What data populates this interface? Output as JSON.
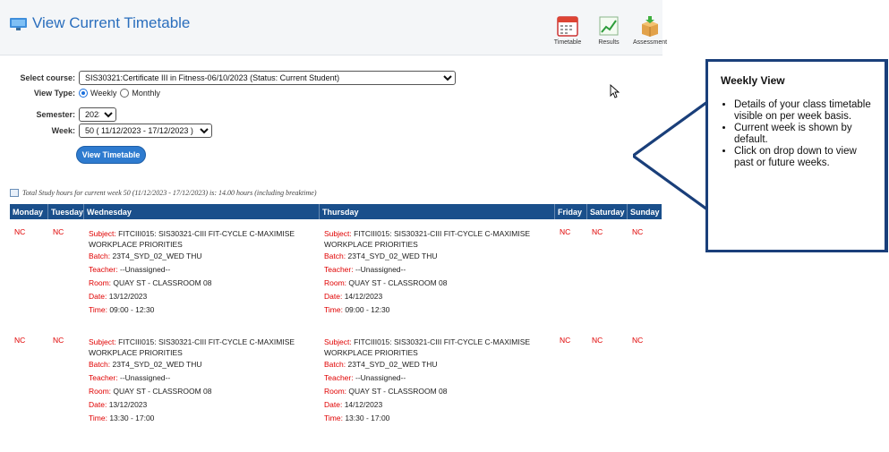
{
  "header": {
    "title": "View Current Timetable",
    "title_icon": "monitor-icon",
    "quick_links": [
      {
        "label": "Timetable",
        "icon": "calendar-icon"
      },
      {
        "label": "Results",
        "icon": "chart-icon"
      },
      {
        "label": "Assessment",
        "icon": "box-icon"
      }
    ]
  },
  "form": {
    "course_label": "Select course:",
    "course_value": "SIS30321:Certificate III in Fitness-06/10/2023 (Status: Current Student)",
    "view_type_label": "View Type:",
    "view_type_options": [
      "Weekly",
      "Monthly"
    ],
    "view_type_selected": "Weekly",
    "semester_label": "Semester:",
    "semester_value": "2023",
    "week_label": "Week:",
    "week_value": "50 ( 11/12/2023 - 17/12/2023 )",
    "view_button": "View Timetable"
  },
  "summary": "Total Study hours for current week 50 (11/12/2023 - 17/12/2023) is: 14.00 hours (including breaktime)",
  "table": {
    "headers": [
      "Monday",
      "Tuesday",
      "Wednesday",
      "Thursday",
      "Friday",
      "Saturday",
      "Sunday"
    ],
    "nc": "NC",
    "rows": [
      {
        "wednesday": {
          "subject_label": "Subject:",
          "subject_value": "FITCIII015: SIS30321-CIII FIT-CYCLE C-MAXIMISE",
          "subject_cont": "WORKPLACE PRIORITIES",
          "batch_label": "Batch:",
          "batch_value": "23T4_SYD_02_WED THU",
          "teacher_label": "Teacher:",
          "teacher_value": "--Unassigned--",
          "room_label": "Room:",
          "room_value": "QUAY ST - CLASSROOM 08",
          "date_label": "Date:",
          "date_value": "13/12/2023",
          "time_label": "Time:",
          "time_value": "09:00 - 12:30"
        },
        "thursday": {
          "subject_label": "Subject:",
          "subject_value": "FITCIII015: SIS30321-CIII FIT-CYCLE C-MAXIMISE",
          "subject_cont": "WORKPLACE PRIORITIES",
          "batch_label": "Batch:",
          "batch_value": "23T4_SYD_02_WED THU",
          "teacher_label": "Teacher:",
          "teacher_value": "--Unassigned--",
          "room_label": "Room:",
          "room_value": "QUAY ST - CLASSROOM 08",
          "date_label": "Date:",
          "date_value": "14/12/2023",
          "time_label": "Time:",
          "time_value": "09:00 - 12:30"
        }
      },
      {
        "wednesday": {
          "subject_label": "Subject:",
          "subject_value": "FITCIII015: SIS30321-CIII FIT-CYCLE C-MAXIMISE",
          "subject_cont": "WORKPLACE PRIORITIES",
          "batch_label": "Batch:",
          "batch_value": "23T4_SYD_02_WED THU",
          "teacher_label": "Teacher:",
          "teacher_value": "--Unassigned--",
          "room_label": "Room:",
          "room_value": "QUAY ST - CLASSROOM 08",
          "date_label": "Date:",
          "date_value": "13/12/2023",
          "time_label": "Time:",
          "time_value": "13:30 - 17:00"
        },
        "thursday": {
          "subject_label": "Subject:",
          "subject_value": "FITCIII015: SIS30321-CIII FIT-CYCLE C-MAXIMISE",
          "subject_cont": "WORKPLACE PRIORITIES",
          "batch_label": "Batch:",
          "batch_value": "23T4_SYD_02_WED THU",
          "teacher_label": "Teacher:",
          "teacher_value": "--Unassigned--",
          "room_label": "Room:",
          "room_value": "QUAY ST - CLASSROOM 08",
          "date_label": "Date:",
          "date_value": "14/12/2023",
          "time_label": "Time:",
          "time_value": "13:30 - 17:00"
        }
      }
    ]
  },
  "callout": {
    "title": "Weekly View",
    "bullets": [
      "Details of your class timetable visible on per week basis.",
      "Current week is shown by default.",
      "Click on drop down to view past or future weeks."
    ]
  },
  "colors": {
    "accent": "#2a6ebd",
    "table_header": "#1a4f8b",
    "label_red": "#e00000",
    "callout_border": "#1a3f7a"
  }
}
